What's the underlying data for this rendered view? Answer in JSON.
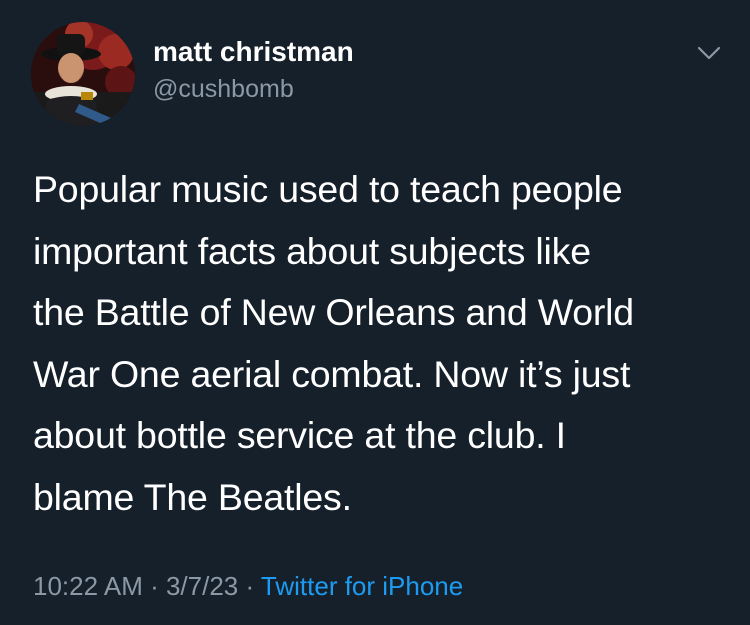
{
  "author": {
    "display_name": "matt christman",
    "handle": "@cushbomb"
  },
  "tweet": {
    "lines": [
      "Popular music used to teach people",
      "important facts about subjects like",
      "the Battle of New Orleans and World",
      "War One aerial combat. Now it’s just",
      "about bottle service at the club. I",
      "blame The Beatles."
    ]
  },
  "meta": {
    "time": "10:22 AM",
    "separator": " · ",
    "date": "3/7/23",
    "source": "Twitter for iPhone"
  },
  "icons": {
    "menu": "chevron-down-icon",
    "avatar": "profile-avatar"
  },
  "colors": {
    "background": "#15202b",
    "text": "#ffffff",
    "secondary": "#8b98a5",
    "link": "#1d9bf0"
  }
}
